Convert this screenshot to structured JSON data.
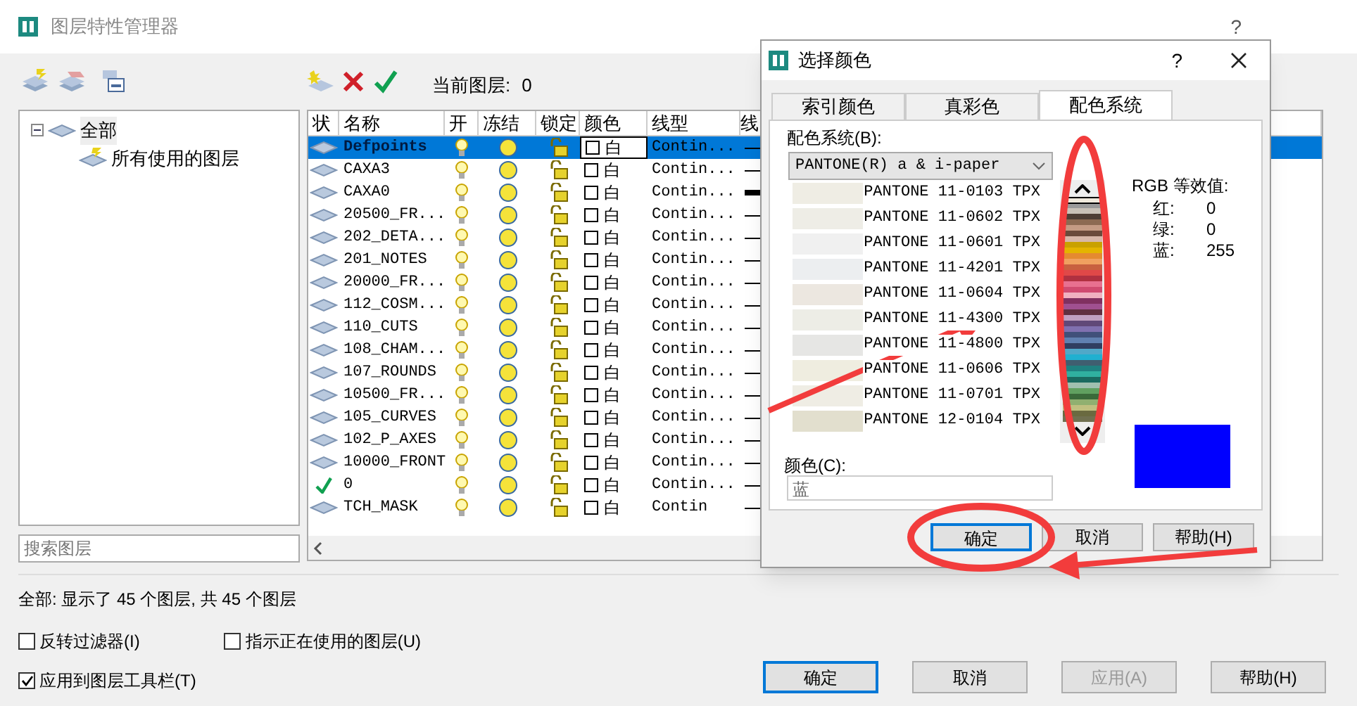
{
  "window": {
    "title": "图层特性管理器",
    "help": "?"
  },
  "current_layer": {
    "label": "当前图层:",
    "value": "0"
  },
  "tree": {
    "label": "全部",
    "expanded": true,
    "children": [
      {
        "label": "所有使用的图层"
      }
    ]
  },
  "search": {
    "placeholder": "搜索图层"
  },
  "table": {
    "columns": [
      "状",
      "名称",
      "开",
      "冻结",
      "锁定",
      "颜色",
      "线型",
      "线"
    ],
    "rows": [
      {
        "kind": "layer",
        "name": "Defpoints",
        "color_name": "白",
        "linetype": "Contin...",
        "thick": false,
        "selected": true
      },
      {
        "kind": "layer",
        "name": "CAXA3",
        "color_name": "白",
        "linetype": "Contin...",
        "thick": false,
        "selected": false
      },
      {
        "kind": "layer",
        "name": "CAXA0",
        "color_name": "白",
        "linetype": "Contin...",
        "thick": true,
        "selected": false
      },
      {
        "kind": "layer",
        "name": "20500_FR...",
        "color_name": "白",
        "linetype": "Contin...",
        "thick": false,
        "selected": false
      },
      {
        "kind": "layer",
        "name": "202_DETA...",
        "color_name": "白",
        "linetype": "Contin...",
        "thick": false,
        "selected": false
      },
      {
        "kind": "layer",
        "name": "201_NOTES",
        "color_name": "白",
        "linetype": "Contin...",
        "thick": false,
        "selected": false
      },
      {
        "kind": "layer",
        "name": "20000_FR...",
        "color_name": "白",
        "linetype": "Contin...",
        "thick": false,
        "selected": false
      },
      {
        "kind": "layer",
        "name": "112_COSM...",
        "color_name": "白",
        "linetype": "Contin...",
        "thick": false,
        "selected": false
      },
      {
        "kind": "layer",
        "name": "110_CUTS",
        "color_name": "白",
        "linetype": "Contin...",
        "thick": false,
        "selected": false
      },
      {
        "kind": "layer",
        "name": "108_CHAM...",
        "color_name": "白",
        "linetype": "Contin...",
        "thick": false,
        "selected": false
      },
      {
        "kind": "layer",
        "name": "107_ROUNDS",
        "color_name": "白",
        "linetype": "Contin...",
        "thick": false,
        "selected": false
      },
      {
        "kind": "layer",
        "name": "10500_FR...",
        "color_name": "白",
        "linetype": "Contin...",
        "thick": false,
        "selected": false
      },
      {
        "kind": "layer",
        "name": "105_CURVES",
        "color_name": "白",
        "linetype": "Contin...",
        "thick": false,
        "selected": false
      },
      {
        "kind": "layer",
        "name": "102_P_AXES",
        "color_name": "白",
        "linetype": "Contin...",
        "thick": false,
        "selected": false
      },
      {
        "kind": "layer",
        "name": "10000_FRONT",
        "color_name": "白",
        "linetype": "Contin...",
        "thick": false,
        "selected": false
      },
      {
        "kind": "current",
        "name": "0",
        "color_name": "白",
        "linetype": "Contin...",
        "thick": false,
        "selected": false
      },
      {
        "kind": "layer",
        "name": "TCH_MASK",
        "color_name": "白",
        "linetype": "Contin",
        "thick": false,
        "selected": false
      }
    ]
  },
  "status": "全部: 显示了 45 个图层, 共 45 个图层",
  "options": [
    {
      "label": "反转过滤器(I)",
      "checked": false
    },
    {
      "label": "指示正在使用的图层(U)",
      "checked": false
    },
    {
      "label": "应用到图层工具栏(T)",
      "checked": true
    }
  ],
  "buttons": [
    {
      "label": "确定",
      "default": true,
      "disabled": false
    },
    {
      "label": "取消",
      "default": false,
      "disabled": false
    },
    {
      "label": "应用(A)",
      "default": false,
      "disabled": true
    },
    {
      "label": "帮助(H)",
      "default": false,
      "disabled": false
    }
  ],
  "dialog": {
    "title": "选择颜色",
    "help": "?",
    "tabs": [
      {
        "label": "索引颜色",
        "selected": false
      },
      {
        "label": "真彩色",
        "selected": false
      },
      {
        "label": "配色系统",
        "selected": true
      }
    ],
    "book_label": "配色系统(B):",
    "book": "PANTONE(R) a & i-paper",
    "swatches": [
      {
        "name": "PANTONE 11-0103 TPX",
        "color": "#efede4"
      },
      {
        "name": "PANTONE 11-0602 TPX",
        "color": "#eeede6"
      },
      {
        "name": "PANTONE 11-0601 TPX",
        "color": "#f0f0f0"
      },
      {
        "name": "PANTONE 11-4201 TPX",
        "color": "#eceef0"
      },
      {
        "name": "PANTONE 11-0604 TPX",
        "color": "#ece7e0"
      },
      {
        "name": "PANTONE 11-4300 TPX",
        "color": "#edede6"
      },
      {
        "name": "PANTONE 11-4800 TPX",
        "color": "#e6e6e4"
      },
      {
        "name": "PANTONE 11-0606 TPX",
        "color": "#efede0"
      },
      {
        "name": "PANTONE 11-0701 TPX",
        "color": "#efede4"
      },
      {
        "name": "PANTONE 12-0104 TPX",
        "color": "#e2dfce"
      }
    ],
    "rgb_label": "RGB 等效值:",
    "rgb": [
      {
        "label": "红:",
        "value": "0"
      },
      {
        "label": "绿:",
        "value": "0"
      },
      {
        "label": "蓝:",
        "value": "255"
      }
    ],
    "strip": {
      "level": 0
    },
    "color_label": "颜色(C):",
    "color_value": "蓝",
    "buttons": [
      {
        "label": "确定",
        "default": true
      },
      {
        "label": "取消",
        "default": false
      },
      {
        "label": "帮助(H)",
        "default": false
      }
    ]
  }
}
